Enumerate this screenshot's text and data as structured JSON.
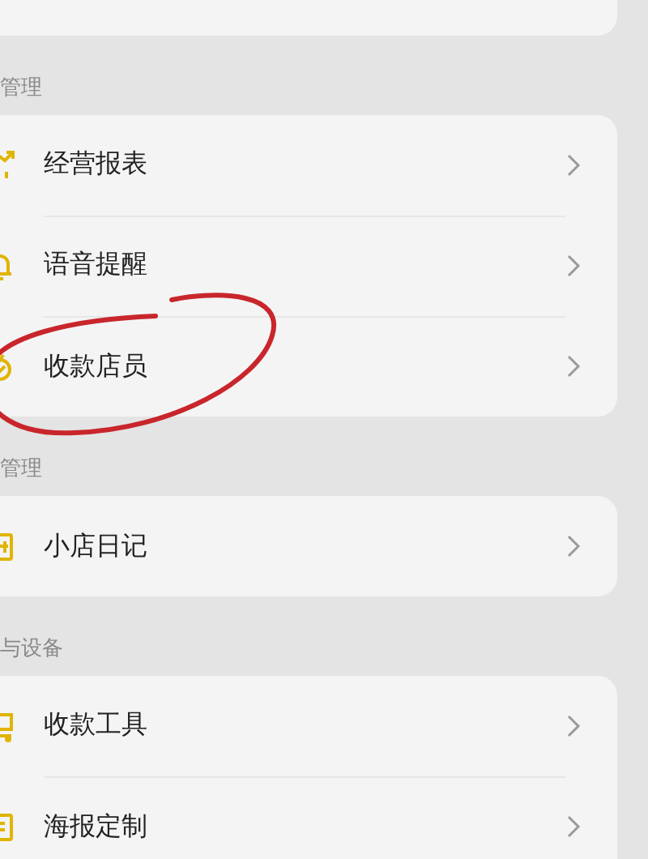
{
  "sections": [
    {
      "title": "管理",
      "items": [
        {
          "label": "经营报表",
          "circled": false
        },
        {
          "label": "语音提醒",
          "circled": false
        },
        {
          "label": "收款店员",
          "circled": true
        }
      ]
    },
    {
      "title": "管理",
      "items": [
        {
          "label": "小店日记",
          "circled": false
        }
      ]
    },
    {
      "title": "与设备",
      "items": [
        {
          "label": "收款工具",
          "circled": false
        },
        {
          "label": "海报定制",
          "circled": false
        }
      ]
    }
  ]
}
